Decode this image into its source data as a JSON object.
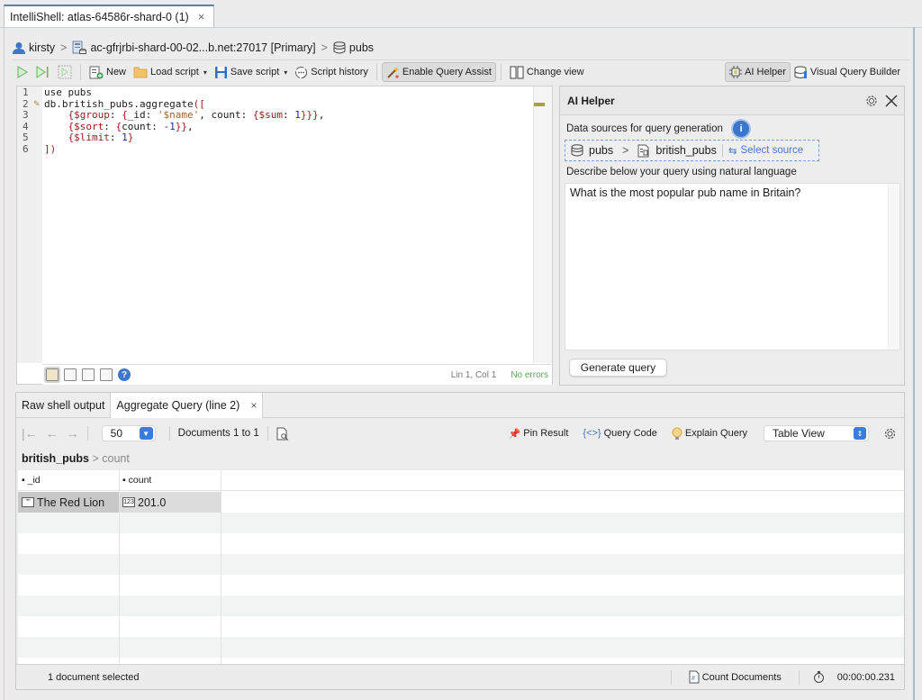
{
  "window": {
    "tab_title": "IntelliShell: atlas-64586r-shard-0 (1)",
    "tab_close": "×"
  },
  "breadcrumb": {
    "user": "kirsty",
    "server": "ac-gfrjrbi-shard-00-02...b.net:27017 [Primary]",
    "database": "pubs",
    "separator": ">"
  },
  "toolbar": {
    "new_label": "New",
    "load_label": "Load script",
    "save_label": "Save script",
    "history_label": "Script history",
    "query_assist_label": "Enable Query Assist",
    "change_view_label": "Change view",
    "ai_helper_label": "AI Helper",
    "vqb_label": "Visual Query Builder",
    "dropdown_caret": "▾"
  },
  "editor": {
    "line_numbers": [
      "1",
      "2",
      "3",
      "4",
      "5",
      "6"
    ],
    "lines": [
      "use pubs",
      "db.british_pubs.aggregate([",
      "    {$group: {_id: '$name', count: {$sum: 1}}},",
      "    {$sort: {count: -1}},",
      "    {$limit: 1}",
      "])"
    ],
    "cursor_position": "Lin 1, Col 1",
    "error_status": "No errors",
    "help_glyph": "?"
  },
  "ai_helper": {
    "title": "AI Helper",
    "data_sources_label": "Data sources for query generation",
    "info_glyph": "i",
    "source_db": "pubs",
    "source_collection": "british_pubs",
    "select_source_label": "Select source",
    "describe_label": "Describe below your query using natural language",
    "query_text": "What is the most popular pub name in Britain?",
    "generate_button": "Generate query"
  },
  "results": {
    "tabs": [
      {
        "label": "Raw shell output",
        "active": false
      },
      {
        "label": "Aggregate Query (line 2)",
        "active": true,
        "closable": true
      }
    ],
    "page_size": "50",
    "documents_range": "Documents 1 to 1",
    "pin_result_label": "Pin Result",
    "query_code_label": "Query Code",
    "explain_query_label": "Explain Query",
    "view_mode": "Table View",
    "path_collection": "british_pubs",
    "path_field": "count",
    "columns": [
      "_id",
      "count"
    ],
    "rows": [
      {
        "_id": "The Red Lion",
        "count": "201.0"
      }
    ],
    "status_selected": "1 document selected",
    "count_documents_label": "Count Documents",
    "elapsed_time": "00:00:00.231"
  },
  "colors": {
    "accent_blue": "#3d77c9",
    "no_errors_green": "#5aa45a",
    "select_source_blue": "#4a79cf",
    "selected_row_id_bg": "#c8c8c8",
    "selected_row_count_bg": "#dcdcdc"
  }
}
